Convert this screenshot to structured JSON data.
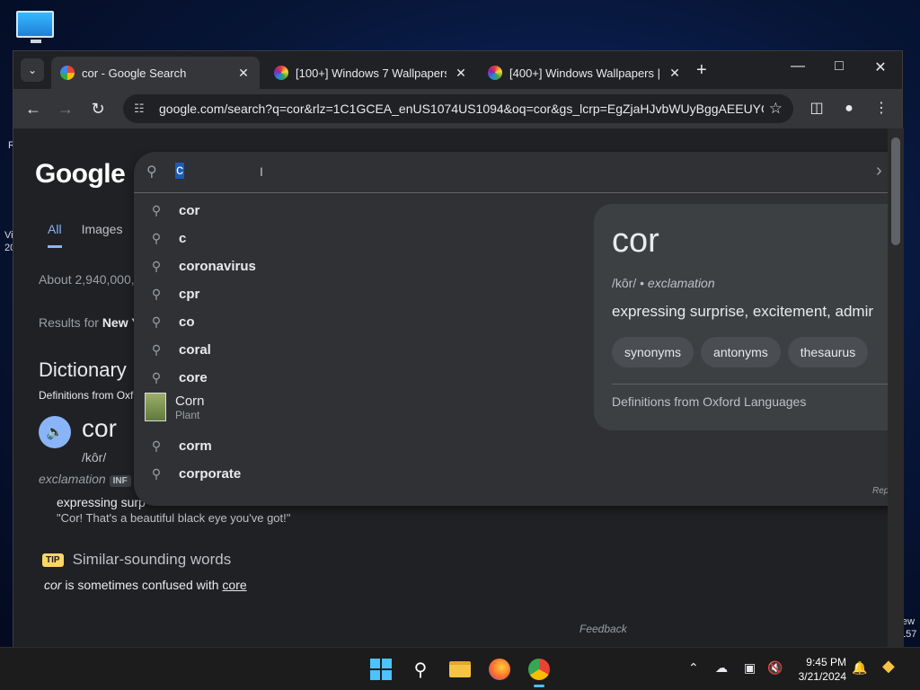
{
  "desktop": {
    "edge_left_1": "R",
    "edge_left_2": "Vi",
    "edge_left_3": "20",
    "edge_right_1": "ew",
    "edge_right_2": "157"
  },
  "browser": {
    "tabs": [
      {
        "title": "cor - Google Search",
        "favicon": "google-icon"
      },
      {
        "title": "[100+] Windows 7 Wallpapers | W",
        "favicon": "wallpaper-site-icon"
      },
      {
        "title": "[400+] Windows Wallpapers | W",
        "favicon": "wallpaper-site-icon"
      }
    ],
    "url": "google.com/search?q=cor&rlz=1C1GCEA_enUS1074US1094&oq=cor&gs_lcrp=EgZjaHJvbWUyBggAEEUYO..."
  },
  "page": {
    "logo": "Google",
    "tabs": [
      "All",
      "Images"
    ],
    "result_count": "About 2,940,000,",
    "results_for_prefix": "Results for ",
    "results_for_place": "New Y",
    "dictionary_heading": "Dictionary",
    "dictionary_sub": "Definitions from Oxf",
    "word": "cor",
    "pronunciation": "/kôr/",
    "part_of_speech": "exclamation",
    "pos_badge": "INF",
    "definition": "expressing surp",
    "example": "\"Cor! That's a beautiful black eye you've got!\"",
    "tip_badge": "TIP",
    "tip_label": "Similar-sounding words",
    "confused_word": "cor",
    "confused_text": " is sometimes confused with ",
    "confused_link": "core",
    "feedback": "Feedback"
  },
  "autocomplete": {
    "input_value": "c",
    "suggestions": [
      "cor",
      "c",
      "coronavirus",
      "cpr",
      "co",
      "coral",
      "core"
    ],
    "corn_title": "Corn",
    "corn_subtitle": "Plant",
    "suggestions_after": [
      "corm",
      "corporate"
    ],
    "report": "Rep"
  },
  "knowledge_card": {
    "word": "cor",
    "pronunciation": "/kôr/",
    "separator": " • ",
    "pos": "exclamation",
    "definition": "expressing surprise, excitement, admir",
    "chips": [
      "synonyms",
      "antonyms",
      "thesaurus"
    ],
    "source": "Definitions from Oxford Languages"
  },
  "taskbar": {
    "time": "9:45 PM",
    "date": "3/21/2024"
  },
  "colors": {
    "accent": "#8ab4f8",
    "windows_accent": "#4cc2ff"
  }
}
